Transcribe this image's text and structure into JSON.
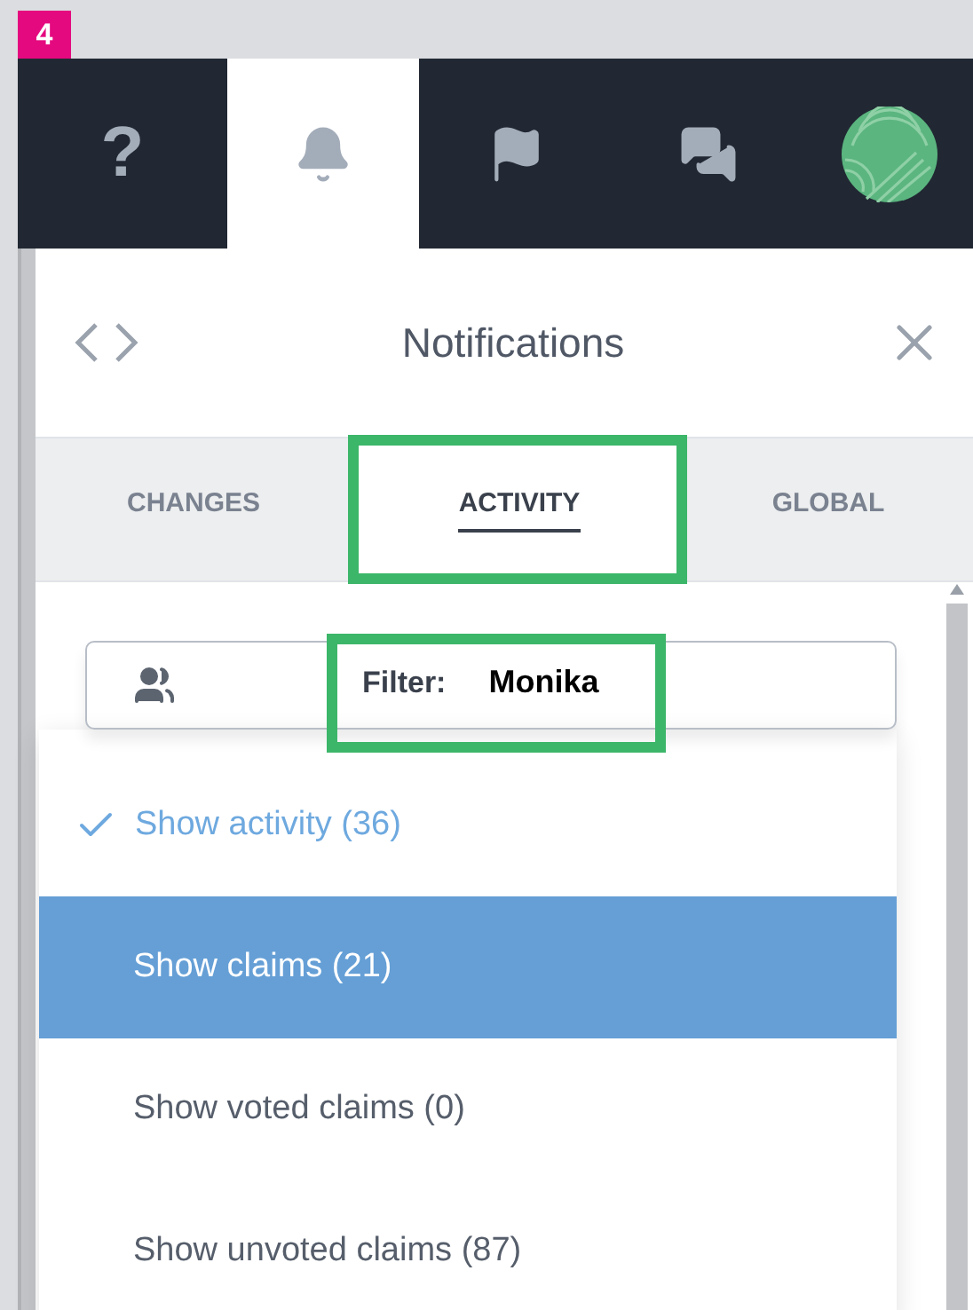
{
  "step_badge": "4",
  "nav": [
    {
      "kind": "help",
      "glyph": "?",
      "selected": false
    },
    {
      "kind": "bell",
      "selected": true
    },
    {
      "kind": "flag",
      "selected": false
    },
    {
      "kind": "chat",
      "selected": false
    },
    {
      "kind": "avatar",
      "selected": false
    }
  ],
  "panel": {
    "title": "Notifications"
  },
  "tabs": [
    {
      "label": "CHANGES",
      "selected": false,
      "callout": false
    },
    {
      "label": "ACTIVITY",
      "selected": true,
      "callout": true
    },
    {
      "label": "GLOBAL",
      "selected": false,
      "callout": false
    }
  ],
  "filter": {
    "label": "Filter:",
    "value": "Monika",
    "callout": true
  },
  "menu": [
    {
      "label": "Show activity (36)",
      "checked": true,
      "selected": false
    },
    {
      "label": "Show claims (21)",
      "checked": false,
      "selected": true
    },
    {
      "label": "Show voted claims (0)",
      "checked": false,
      "selected": false
    },
    {
      "label": "Show unvoted claims (87)",
      "checked": false,
      "selected": false
    }
  ]
}
